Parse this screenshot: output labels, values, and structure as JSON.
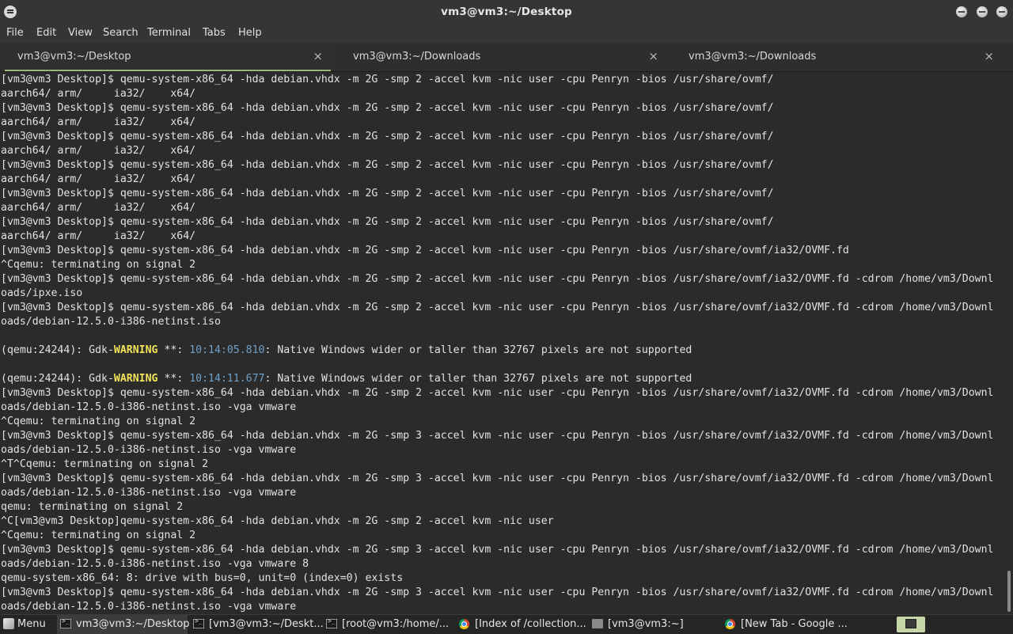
{
  "window": {
    "title": "vm3@vm3:~/Desktop"
  },
  "menubar": [
    "File",
    "Edit",
    "View",
    "Search",
    "Terminal",
    "Tabs",
    "Help"
  ],
  "tabs": [
    {
      "label": "vm3@vm3:~/Desktop",
      "close": "×",
      "active": true
    },
    {
      "label": "vm3@vm3:~/Downloads",
      "close": "×",
      "active": false
    },
    {
      "label": "vm3@vm3:~/Downloads",
      "close": "×",
      "active": false
    }
  ],
  "terminal_lines": [
    "[vm3@vm3 Desktop]$ qemu-system-x86_64 -hda debian.vhdx -m 2G -smp 2 -accel kvm -nic user -cpu Penryn -bios /usr/share/ovmf/",
    "aarch64/ arm/     ia32/    x64/",
    "[vm3@vm3 Desktop]$ qemu-system-x86_64 -hda debian.vhdx -m 2G -smp 2 -accel kvm -nic user -cpu Penryn -bios /usr/share/ovmf/",
    "aarch64/ arm/     ia32/    x64/",
    "[vm3@vm3 Desktop]$ qemu-system-x86_64 -hda debian.vhdx -m 2G -smp 2 -accel kvm -nic user -cpu Penryn -bios /usr/share/ovmf/",
    "aarch64/ arm/     ia32/    x64/",
    "[vm3@vm3 Desktop]$ qemu-system-x86_64 -hda debian.vhdx -m 2G -smp 2 -accel kvm -nic user -cpu Penryn -bios /usr/share/ovmf/",
    "aarch64/ arm/     ia32/    x64/",
    "[vm3@vm3 Desktop]$ qemu-system-x86_64 -hda debian.vhdx -m 2G -smp 2 -accel kvm -nic user -cpu Penryn -bios /usr/share/ovmf/",
    "aarch64/ arm/     ia32/    x64/",
    "[vm3@vm3 Desktop]$ qemu-system-x86_64 -hda debian.vhdx -m 2G -smp 2 -accel kvm -nic user -cpu Penryn -bios /usr/share/ovmf/",
    "aarch64/ arm/     ia32/    x64/",
    "[vm3@vm3 Desktop]$ qemu-system-x86_64 -hda debian.vhdx -m 2G -smp 2 -accel kvm -nic user -cpu Penryn -bios /usr/share/ovmf/ia32/OVMF.fd",
    "^Cqemu: terminating on signal 2",
    "[vm3@vm3 Desktop]$ qemu-system-x86_64 -hda debian.vhdx -m 2G -smp 2 -accel kvm -nic user -cpu Penryn -bios /usr/share/ovmf/ia32/OVMF.fd -cdrom /home/vm3/Downl",
    "oads/ipxe.iso",
    "[vm3@vm3 Desktop]$ qemu-system-x86_64 -hda debian.vhdx -m 2G -smp 2 -accel kvm -nic user -cpu Penryn -bios /usr/share/ovmf/ia32/OVMF.fd -cdrom /home/vm3/Downl",
    "oads/debian-12.5.0-i386-netinst.iso",
    "",
    "(qemu:24244): Gdk-WARNING **: 10:14:05.810: Native Windows wider or taller than 32767 pixels are not supported",
    "",
    "(qemu:24244): Gdk-WARNING **: 10:14:11.677: Native Windows wider or taller than 32767 pixels are not supported",
    "[vm3@vm3 Desktop]$ qemu-system-x86_64 -hda debian.vhdx -m 2G -smp 2 -accel kvm -nic user -cpu Penryn -bios /usr/share/ovmf/ia32/OVMF.fd -cdrom /home/vm3/Downl",
    "oads/debian-12.5.0-i386-netinst.iso -vga vmware",
    "^Cqemu: terminating on signal 2",
    "[vm3@vm3 Desktop]$ qemu-system-x86_64 -hda debian.vhdx -m 2G -smp 3 -accel kvm -nic user -cpu Penryn -bios /usr/share/ovmf/ia32/OVMF.fd -cdrom /home/vm3/Downl",
    "oads/debian-12.5.0-i386-netinst.iso -vga vmware",
    "^T^Cqemu: terminating on signal 2",
    "[vm3@vm3 Desktop]$ qemu-system-x86_64 -hda debian.vhdx -m 2G -smp 3 -accel kvm -nic user -cpu Penryn -bios /usr/share/ovmf/ia32/OVMF.fd -cdrom /home/vm3/Downl",
    "oads/debian-12.5.0-i386-netinst.iso -vga vmware",
    "qemu: terminating on signal 2",
    "^C[vm3@vm3 Desktop]qemu-system-x86_64 -hda debian.vhdx -m 2G -smp 2 -accel kvm -nic user",
    "^Cqemu: terminating on signal 2",
    "[vm3@vm3 Desktop]$ qemu-system-x86_64 -hda debian.vhdx -m 2G -smp 3 -accel kvm -nic user -cpu Penryn -bios /usr/share/ovmf/ia32/OVMF.fd -cdrom /home/vm3/Downl",
    "oads/debian-12.5.0-i386-netinst.iso -vga vmware 8",
    "qemu-system-x86_64: 8: drive with bus=0, unit=0 (index=0) exists",
    "[vm3@vm3 Desktop]$ qemu-system-x86_64 -hda debian.vhdx -m 2G -smp 3 -accel kvm -nic user -cpu Penryn -bios /usr/share/ovmf/ia32/OVMF.fd -cdrom /home/vm3/Downl",
    "oads/debian-12.5.0-i386-netinst.iso -vga vmware"
  ],
  "taskbar": {
    "menu_label": "Menu",
    "tasks": [
      {
        "label": "vm3@vm3:~/Desktop",
        "icon": "terminal-icon",
        "active": true
      },
      {
        "label": "[vm3@vm3:~/Deskt...",
        "icon": "terminal-icon",
        "active": false
      },
      {
        "label": "[root@vm3:/home/...",
        "icon": "terminal-icon",
        "active": false
      },
      {
        "label": "[Index of /collection...",
        "icon": "chrome-icon",
        "active": false
      },
      {
        "label": "[vm3@vm3:~]",
        "icon": "folder-icon",
        "active": false
      },
      {
        "label": "[New Tab - Google ...",
        "icon": "chrome-icon",
        "active": false
      }
    ]
  },
  "colors": {
    "terminal_bg": "#2b2b2b",
    "terminal_fg": "#e2e2e2",
    "warning": "#f2e35a",
    "timestamp": "#6fa0c8",
    "active_tab_accent": "#9ab87c"
  }
}
